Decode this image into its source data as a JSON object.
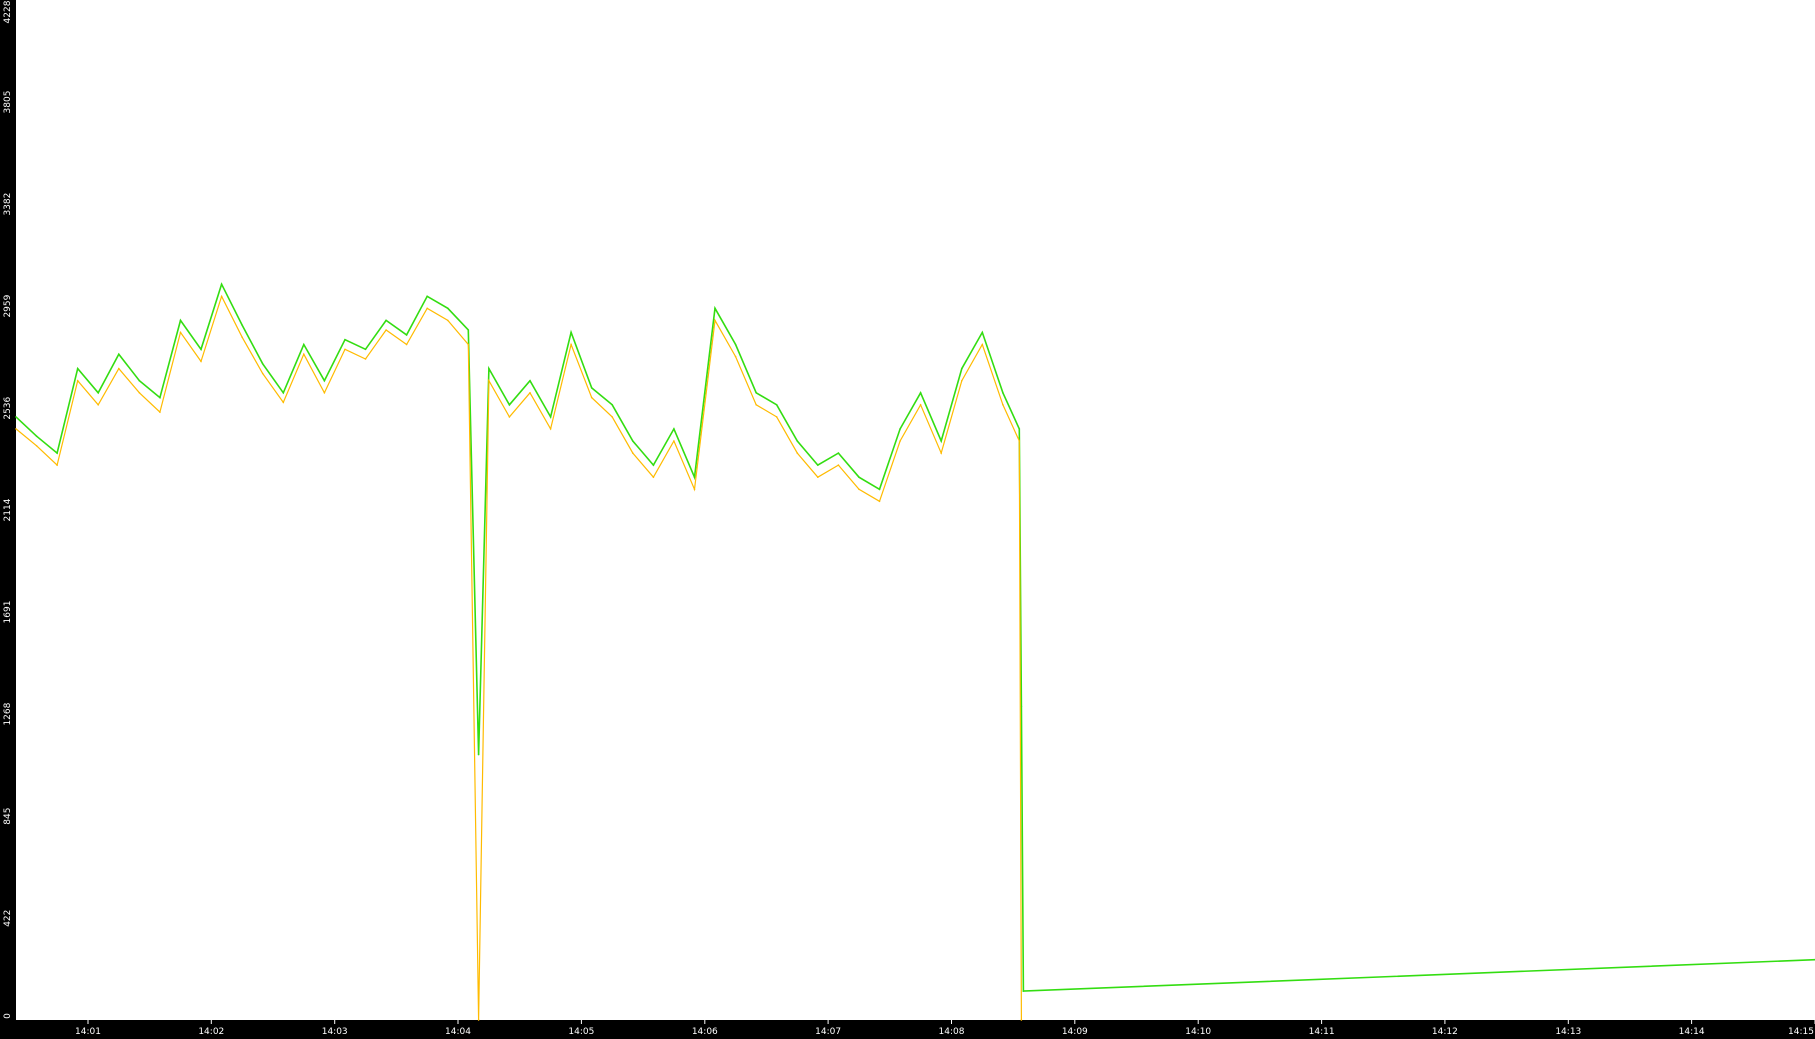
{
  "chart_data": {
    "type": "line",
    "title": "",
    "xlabel": "",
    "ylabel": "",
    "background_color": "#000000",
    "plot_area_color": "#ffffff",
    "axis_text_color": "#ffffff",
    "grid": false,
    "legend": "none",
    "ylim": [
      0,
      4228
    ],
    "xlim": [
      "14:00:25",
      "14:15:00"
    ],
    "y_ticks": [
      0,
      422,
      845,
      1268,
      1691,
      2114,
      2536,
      2959,
      3382,
      3805,
      4228
    ],
    "x_ticks": [
      "14:01",
      "14:02",
      "14:03",
      "14:04",
      "14:05",
      "14:06",
      "14:07",
      "14:08",
      "14:09",
      "14:10",
      "14:11",
      "14:12",
      "14:13",
      "14:14",
      "14:15"
    ],
    "series": [
      {
        "color": "#33dd11",
        "x": [
          "14:00:25",
          "14:00:35",
          "14:00:45",
          "14:00:55",
          "14:01:05",
          "14:01:15",
          "14:01:25",
          "14:01:35",
          "14:01:45",
          "14:01:55",
          "14:02:05",
          "14:02:15",
          "14:02:25",
          "14:02:35",
          "14:02:45",
          "14:02:55",
          "14:03:05",
          "14:03:15",
          "14:03:25",
          "14:03:35",
          "14:03:45",
          "14:03:55",
          "14:04:05",
          "14:04:10",
          "14:04:15",
          "14:04:25",
          "14:04:35",
          "14:04:45",
          "14:04:55",
          "14:05:05",
          "14:05:15",
          "14:05:25",
          "14:05:35",
          "14:05:45",
          "14:05:55",
          "14:06:05",
          "14:06:15",
          "14:06:25",
          "14:06:35",
          "14:06:45",
          "14:06:55",
          "14:07:05",
          "14:07:15",
          "14:07:25",
          "14:07:35",
          "14:07:45",
          "14:07:55",
          "14:08:05",
          "14:08:15",
          "14:08:25",
          "14:08:33",
          "14:08:34",
          "14:08:35",
          "14:15:00"
        ],
        "y": [
          2500,
          2420,
          2350,
          2700,
          2600,
          2760,
          2650,
          2580,
          2900,
          2780,
          3050,
          2880,
          2720,
          2600,
          2800,
          2650,
          2820,
          2780,
          2900,
          2840,
          3000,
          2950,
          2860,
          1100,
          2700,
          2550,
          2650,
          2500,
          2850,
          2620,
          2550,
          2400,
          2300,
          2450,
          2250,
          2950,
          2800,
          2600,
          2550,
          2400,
          2300,
          2350,
          2250,
          2200,
          2450,
          2600,
          2400,
          2700,
          2850,
          2600,
          2450,
          1300,
          120,
          250
        ]
      },
      {
        "color": "#ffbb00",
        "x": [
          "14:00:25",
          "14:00:35",
          "14:00:45",
          "14:00:55",
          "14:01:05",
          "14:01:15",
          "14:01:25",
          "14:01:35",
          "14:01:45",
          "14:01:55",
          "14:02:05",
          "14:02:15",
          "14:02:25",
          "14:02:35",
          "14:02:45",
          "14:02:55",
          "14:03:05",
          "14:03:15",
          "14:03:25",
          "14:03:35",
          "14:03:45",
          "14:03:55",
          "14:04:05",
          "14:04:10",
          "14:04:15",
          "14:04:25",
          "14:04:35",
          "14:04:45",
          "14:04:55",
          "14:05:05",
          "14:05:15",
          "14:05:25",
          "14:05:35",
          "14:05:45",
          "14:05:55",
          "14:06:05",
          "14:06:15",
          "14:06:25",
          "14:06:35",
          "14:06:45",
          "14:06:55",
          "14:07:05",
          "14:07:15",
          "14:07:25",
          "14:07:35",
          "14:07:45",
          "14:07:55",
          "14:08:05",
          "14:08:15",
          "14:08:25",
          "14:08:33",
          "14:08:34"
        ],
        "y": [
          2450,
          2380,
          2300,
          2650,
          2550,
          2700,
          2600,
          2520,
          2850,
          2730,
          3000,
          2830,
          2680,
          2560,
          2760,
          2600,
          2780,
          2740,
          2860,
          2800,
          2950,
          2900,
          2800,
          0,
          2650,
          2500,
          2600,
          2450,
          2800,
          2580,
          2500,
          2350,
          2250,
          2400,
          2200,
          2900,
          2750,
          2550,
          2500,
          2350,
          2250,
          2300,
          2200,
          2150,
          2400,
          2550,
          2350,
          2650,
          2800,
          2550,
          2400,
          0
        ]
      }
    ]
  }
}
